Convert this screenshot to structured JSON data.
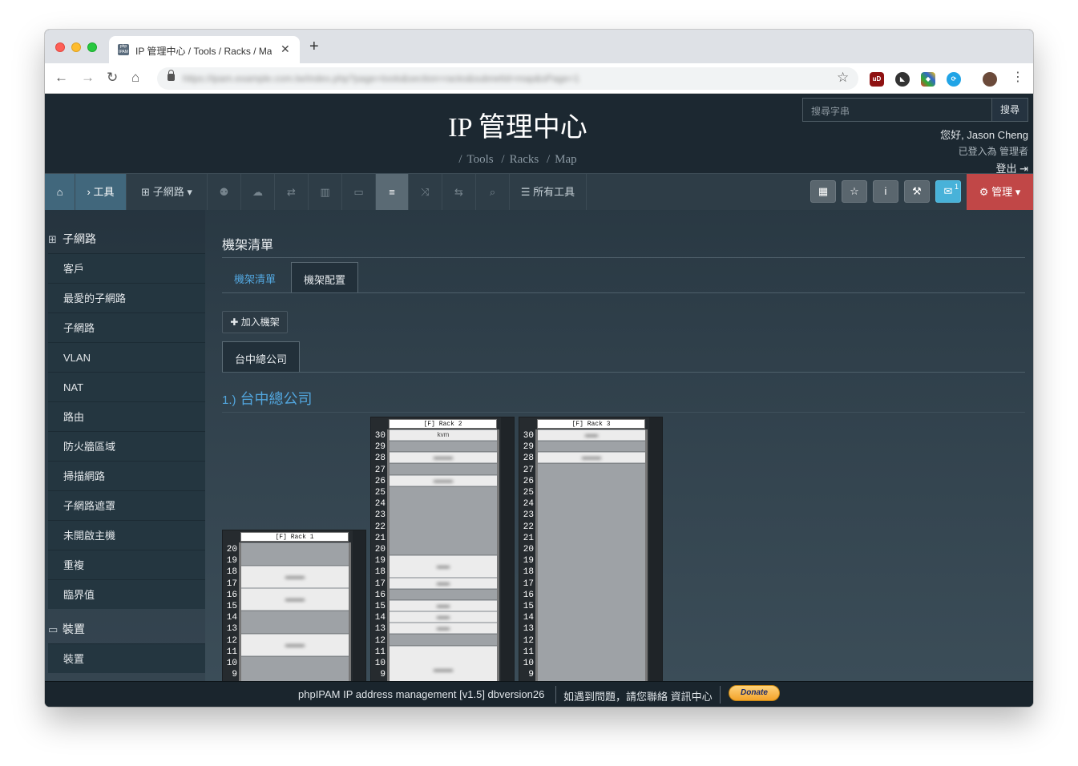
{
  "browser": {
    "tab_title": "IP 管理中心 / Tools / Racks / Map",
    "favicon_text": "php IPAM",
    "url": "https://ipam.example.com.tw/index.php?page=tools&section=racks&subnetId=map&sPage=1"
  },
  "header": {
    "app_title": "IP 管理中心",
    "breadcrumbs": [
      "Tools",
      "Racks",
      "Map"
    ],
    "search_placeholder": "搜尋字串",
    "search_button": "搜尋",
    "greeting": "您好, Jason Cheng",
    "logged_in_as": "已登入為  管理者",
    "logout": "登出"
  },
  "menubar": {
    "tools_label": "工具",
    "subnets_label": "子網路",
    "all_tools_label": "所有工具",
    "admin_label": "管理",
    "mail_count": "1"
  },
  "sidebar": {
    "group1": "子網路",
    "items1": [
      "客戶",
      "最愛的子網路",
      "子網路",
      "VLAN",
      "NAT",
      "路由",
      "防火牆區域",
      "掃描網路",
      "子網路遮罩",
      "未開啟主機",
      "重複",
      "臨界值"
    ],
    "group2": "裝置",
    "items2": [
      "裝置"
    ]
  },
  "content": {
    "title": "機架清單",
    "tab_list": "機架清單",
    "tab_layout": "機架配置",
    "add_button": "加入機架",
    "location_tab": "台中總公司",
    "location_num": "1.)",
    "location_name": "台中總公司"
  },
  "racks": {
    "rack1": {
      "label": "[F] Rack 1",
      "units": [
        "20",
        "19",
        "18",
        "17",
        "16",
        "15",
        "14",
        "13",
        "12",
        "11",
        "10",
        "9"
      ]
    },
    "rack2": {
      "label": "[F] Rack 2",
      "top_device": "kvm",
      "units": [
        "30",
        "29",
        "28",
        "27",
        "26",
        "25",
        "24",
        "23",
        "22",
        "21",
        "20",
        "19",
        "18",
        "17",
        "16",
        "15",
        "14",
        "13",
        "12",
        "11",
        "10",
        "9"
      ]
    },
    "rack3": {
      "label": "[F] Rack 3",
      "units": [
        "30",
        "29",
        "28",
        "27",
        "26",
        "25",
        "24",
        "23",
        "22",
        "21",
        "20",
        "19",
        "18",
        "17",
        "16",
        "15",
        "14",
        "13",
        "12",
        "11",
        "10",
        "9"
      ]
    }
  },
  "footer": {
    "version": "phpIPAM IP address management [v1.5] dbversion26",
    "help": "如遇到問題，請您聯絡 資訊中心",
    "donate": "Donate"
  },
  "colors": {
    "accent": "#52a6de",
    "admin": "#c14747",
    "mail": "#48b2d9"
  }
}
